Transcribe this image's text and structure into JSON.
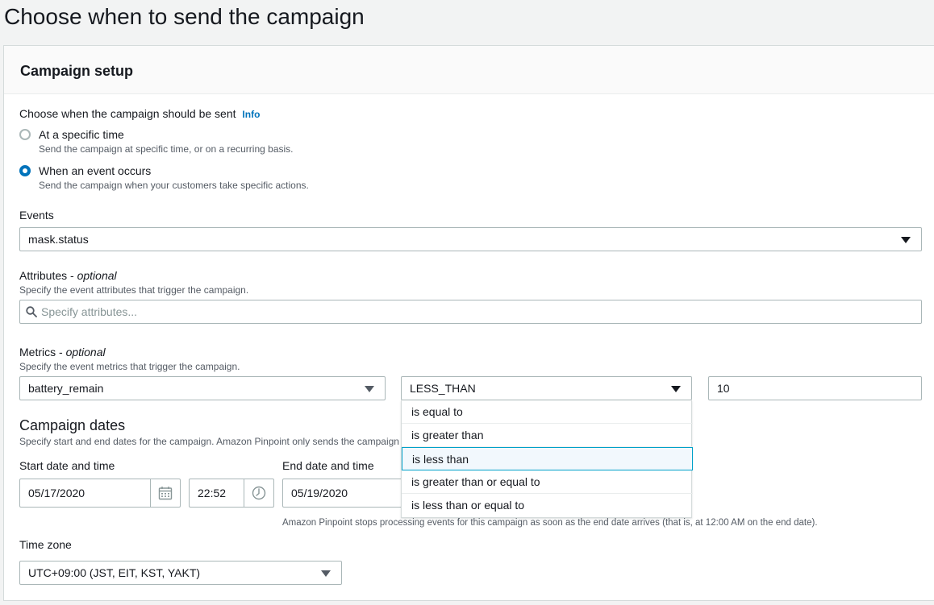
{
  "page_title": "Choose when to send the campaign",
  "panel": {
    "title": "Campaign setup"
  },
  "send_when": {
    "label": "Choose when the campaign should be sent",
    "info": "Info",
    "options": [
      {
        "label": "At a specific time",
        "description": "Send the campaign at specific time, or on a recurring basis.",
        "selected": false
      },
      {
        "label": "When an event occurs",
        "description": "Send the campaign when your customers take specific actions.",
        "selected": true
      }
    ]
  },
  "events": {
    "label": "Events",
    "value": "mask.status"
  },
  "attributes": {
    "label": "Attributes - ",
    "optional": "optional",
    "description": "Specify the event attributes that trigger the campaign.",
    "placeholder": "Specify attributes..."
  },
  "metrics": {
    "label": "Metrics - ",
    "optional": "optional",
    "description": "Specify the event metrics that trigger the campaign.",
    "metric_value": "battery_remain",
    "operator_value": "LESS_THAN",
    "threshold_value": "10",
    "operator_options": [
      {
        "label": "is equal to",
        "highlighted": false
      },
      {
        "label": "is greater than",
        "highlighted": false
      },
      {
        "label": "is less than",
        "highlighted": true
      },
      {
        "label": "is greater than or equal to",
        "highlighted": false
      },
      {
        "label": "is less than or equal to",
        "highlighted": false
      }
    ]
  },
  "campaign_dates": {
    "title": "Campaign dates",
    "description": "Specify start and end dates for the campaign. Amazon Pinpoint only sends the campaign",
    "start_label": "Start date and time",
    "start_date": "05/17/2020",
    "start_time": "22:52",
    "end_label": "End date and time",
    "end_date": "05/19/2020",
    "end_note": "Amazon Pinpoint stops processing events for this campaign as soon as the end date arrives (that is, at 12:00 AM on the end date)."
  },
  "time_zone": {
    "label": "Time zone",
    "value": "UTC+09:00 (JST, EIT, KST, YAKT)"
  },
  "colors": {
    "accent": "#0073bb",
    "highlight_border": "#00a1c9",
    "highlight_bg": "#f2f8fd"
  }
}
